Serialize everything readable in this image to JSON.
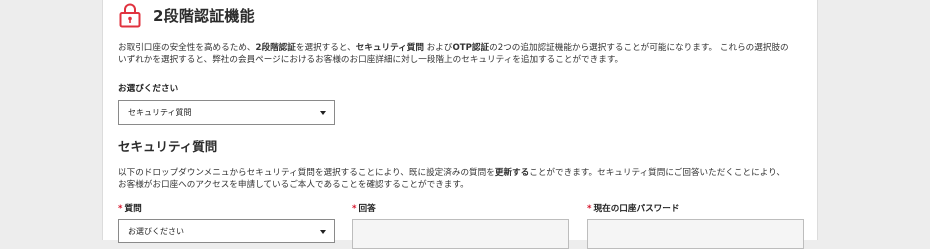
{
  "section": {
    "title": "2段階認証機能",
    "icon": "lock-icon",
    "accent_color": "#e0333f",
    "description_parts": [
      "お取引口座の安全性を高めるため、",
      "2段階認証",
      "を選択すると、",
      "セキュリティ質問",
      " および",
      "OTP認証",
      "の2つの追加認証機能から選択することが可能になります。 これらの選択肢の",
      "いずれかを選択すると、弊社の会員ページにおけるお客様のお口座詳細に対し一段階上のセキュリティを追加することができます。"
    ]
  },
  "method_select": {
    "label": "お選びください",
    "value": "セキュリティ質問"
  },
  "security_question": {
    "title": "セキュリティ質問",
    "description_parts": [
      "以下のドロップダウンメニュからセキュリティ質問を選択することにより、既に設定済みの質問を",
      "更新する",
      "ことができます。セキュリティ質問にご回答いただくことにより、",
      "お客様がお口座へのアクセスを申請しているご本人であることを確認することができます。"
    ],
    "required_mark": "*",
    "question_label": "質問",
    "question_value": "お選びください",
    "answer_label": "回答",
    "password_label": "現在の口座パスワード"
  }
}
